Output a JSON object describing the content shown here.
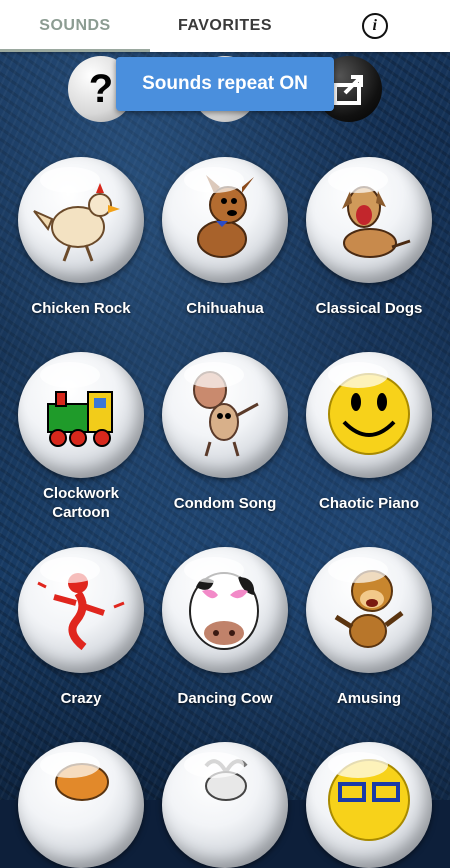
{
  "tabs": [
    {
      "label": "SOUNDS",
      "active": true
    },
    {
      "label": "FAVORITES",
      "active": false
    }
  ],
  "toast": {
    "text": "Sounds repeat ON"
  },
  "top_icons": {
    "help": "?",
    "share": "share-icon"
  },
  "sounds": [
    {
      "label": "Chicken Rock",
      "icon": "chicken-icon"
    },
    {
      "label": "Chihuahua",
      "icon": "dog-icon"
    },
    {
      "label": "Classical Dogs",
      "icon": "howling-dog-icon"
    },
    {
      "label": "Clockwork\nCartoon",
      "icon": "toy-train-icon"
    },
    {
      "label": "Condom Song",
      "icon": "cartoon-figure-icon"
    },
    {
      "label": "Chaotic Piano",
      "icon": "smiley-icon"
    },
    {
      "label": "Crazy",
      "icon": "crazy-figure-icon"
    },
    {
      "label": "Dancing Cow",
      "icon": "cow-icon"
    },
    {
      "label": "Amusing",
      "icon": "monkey-icon"
    }
  ],
  "colors": {
    "toast_bg": "#4a8fdd",
    "active_tab": "#8c9c92"
  }
}
